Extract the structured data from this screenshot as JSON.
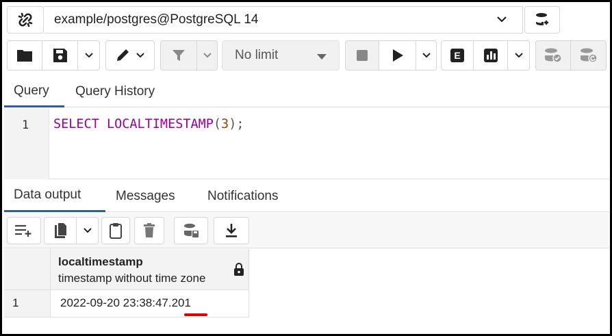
{
  "connection": {
    "label": "example/postgres@PostgreSQL 14",
    "link_icon": "link-icon",
    "db_icon": "database-icon"
  },
  "toolbar": {
    "limit_value": "No limit",
    "limit_badge_letter": "E",
    "icons": [
      "open-folder-icon",
      "save-icon",
      "pen-icon",
      "filter-icon",
      "stop-icon",
      "play-icon",
      "explain-icon",
      "explain-analyze-icon",
      "commit-icon",
      "rollback-icon"
    ]
  },
  "query_tabs": {
    "query": "Query",
    "history": "Query History"
  },
  "editor": {
    "line_number": "1",
    "tokens": {
      "kw1": "SELECT",
      "kw2": "LOCALTIMESTAMP",
      "open": "(",
      "arg": "3",
      "close": ");"
    }
  },
  "output_tabs": {
    "data_output": "Data output",
    "messages": "Messages",
    "notifications": "Notifications"
  },
  "grid": {
    "columns": [
      {
        "name": "localtimestamp",
        "type": "timestamp without time zone"
      }
    ],
    "rows": [
      {
        "num": "1",
        "values": [
          "2022-09-20 23:38:47.201"
        ]
      }
    ]
  },
  "colors": {
    "accent_tab": "#2f5f9a",
    "keyword": "#990099",
    "number": "#8b4513",
    "highlight_underline": "#e00000"
  }
}
